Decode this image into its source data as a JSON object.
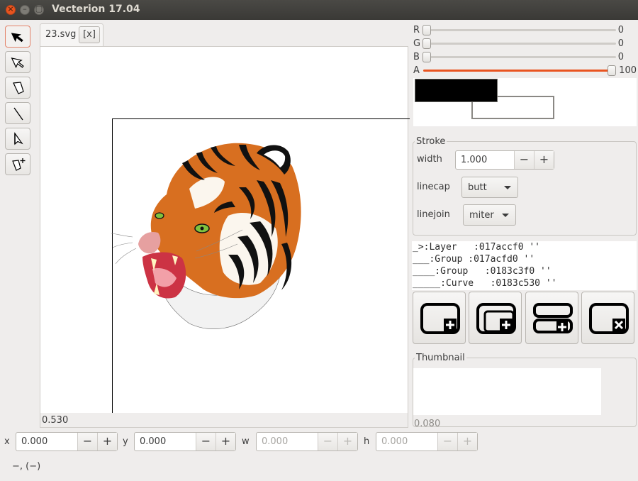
{
  "window": {
    "title": "Vecterion 17.04",
    "close_glyph": "×",
    "min_glyph": "–",
    "max_glyph": "▢"
  },
  "tools": [
    {
      "name": "select-arrow-icon",
      "active": true
    },
    {
      "name": "node-select-arrow-icon",
      "active": false
    },
    {
      "name": "pen-shape-icon",
      "active": false
    },
    {
      "name": "line-icon",
      "active": false
    },
    {
      "name": "node-edit-icon",
      "active": false
    },
    {
      "name": "add-node-icon",
      "active": false
    }
  ],
  "document": {
    "tab_name": "23.svg",
    "tab_close": "[x]",
    "zoom": "0.530"
  },
  "color": {
    "r_label": "R",
    "r_value": "0",
    "g_label": "G",
    "g_value": "0",
    "b_label": "B",
    "b_value": "0",
    "a_label": "A",
    "a_value": "100",
    "accent": "#e95420",
    "foreground": "#000000",
    "background": "#ffffff"
  },
  "stroke": {
    "title": "Stroke",
    "width_label": "width",
    "width_value": "1.000",
    "linecap_label": "linecap",
    "linecap_value": "butt",
    "linejoin_label": "linejoin",
    "linejoin_value": "miter",
    "minus": "−",
    "plus": "+"
  },
  "layers": [
    "_>:Layer   :017accf0 ''",
    "___:Group :017acfd0 ''",
    "____:Group   :0183c3f0 ''",
    "_____:Curve   :0183c530 ''"
  ],
  "layer_actions": [
    {
      "name": "add-layer-icon"
    },
    {
      "name": "add-child-layer-icon"
    },
    {
      "name": "add-layer-below-icon"
    },
    {
      "name": "delete-layer-icon"
    }
  ],
  "thumbnail": {
    "title": "Thumbnail",
    "zoom": "0.080"
  },
  "geometry": {
    "x_label": "x",
    "x_value": "0.000",
    "y_label": "y",
    "y_value": "0.000",
    "w_label": "w",
    "w_value": "0.000",
    "h_label": "h",
    "h_value": "0.000"
  },
  "status": {
    "cursor": "−, (−)"
  }
}
